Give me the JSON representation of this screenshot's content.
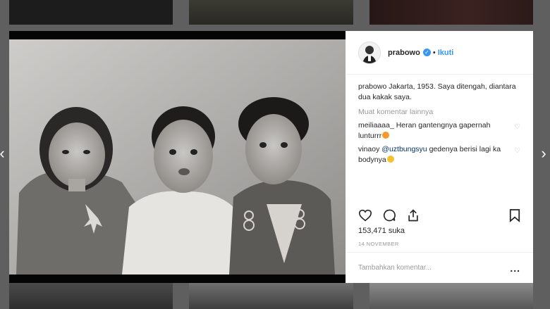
{
  "post": {
    "username": "prabowo",
    "follow_label": "Ikuti",
    "caption_user": "prabowo",
    "caption_text": "Jakarta, 1953. Saya ditengah, diantara dua kakak saya.",
    "load_more_label": "Muat komentar lainnya",
    "comments": [
      {
        "user": "meiliaaaa_",
        "text": "Heran gantengnya gapernah lunturrr",
        "emoji": "cat-emoji"
      },
      {
        "user": "vinaoy",
        "mention": "@uztbungsyu",
        "text": "gedenya berisi lagi ka bodynya",
        "emoji": "heart-eyes-emoji"
      }
    ],
    "likes": "153,471 suka",
    "timestamp": "14 NOVEMBER",
    "comment_placeholder": "Tambahkan komentar...",
    "more_options": "..."
  },
  "nav": {
    "prev": "‹",
    "next": "›"
  },
  "colors": {
    "accent": "#3897f0",
    "mention": "#003569",
    "muted": "#999999"
  },
  "icons": [
    "heart-icon",
    "comment-icon",
    "share-icon",
    "bookmark-icon",
    "verified-icon"
  ]
}
